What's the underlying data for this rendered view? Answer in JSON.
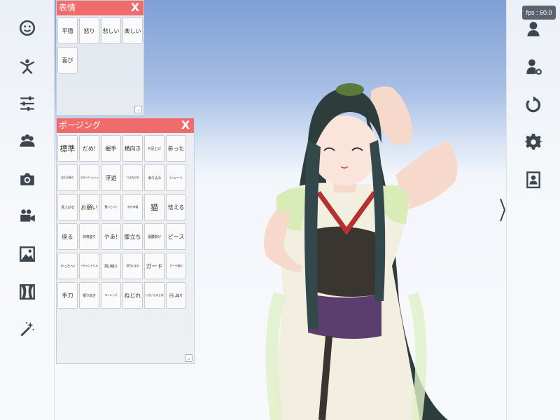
{
  "status": {
    "fps": "fps : 60.0"
  },
  "left_toolbar": [
    {
      "name": "face-icon"
    },
    {
      "name": "pose-icon"
    },
    {
      "name": "sliders-icon"
    },
    {
      "name": "group-icon"
    },
    {
      "name": "camera-icon"
    },
    {
      "name": "video-camera-icon"
    },
    {
      "name": "image-icon"
    },
    {
      "name": "curtain-icon"
    },
    {
      "name": "magic-wand-icon"
    }
  ],
  "right_toolbar": [
    {
      "name": "person-bust-icon"
    },
    {
      "name": "person-settings-icon"
    },
    {
      "name": "reset-icon"
    },
    {
      "name": "gear-icon"
    },
    {
      "name": "portrait-icon"
    }
  ],
  "expression_panel": {
    "title": "表情",
    "close": "X",
    "buttons": [
      "平穏",
      "怒り",
      "悲しい",
      "楽しい",
      "喜び"
    ]
  },
  "posing_panel": {
    "title": "ポージング",
    "close": "X",
    "buttons": [
      "標準",
      "だめ!",
      "握手",
      "横向き",
      "片足上げ",
      "参った",
      "女の子座り",
      "スタイリッシュ",
      "浮遊",
      "つま先立ち",
      "滑り込み",
      "シュート",
      "見上げる",
      "お願い",
      "置いといて",
      "何か幸福",
      "猫",
      "怯える",
      "座る",
      "体育座り",
      "やあ!",
      "膝立ち",
      "蕾腰挙げ",
      "ピース",
      "やった～!",
      "イヤ×ンドリル",
      "飛び蹴り",
      "涙目止まれ",
      "ガード",
      "ガード崩れ",
      "手刀",
      "振り向き",
      "ストレッチ",
      "ねじれ",
      "いろいろまとめ",
      "回し蹴り"
    ]
  },
  "colors": {
    "panel_header": "#f06b6b",
    "sidebar": "#f5f7fa",
    "sky_top": "#7f9fd6"
  }
}
